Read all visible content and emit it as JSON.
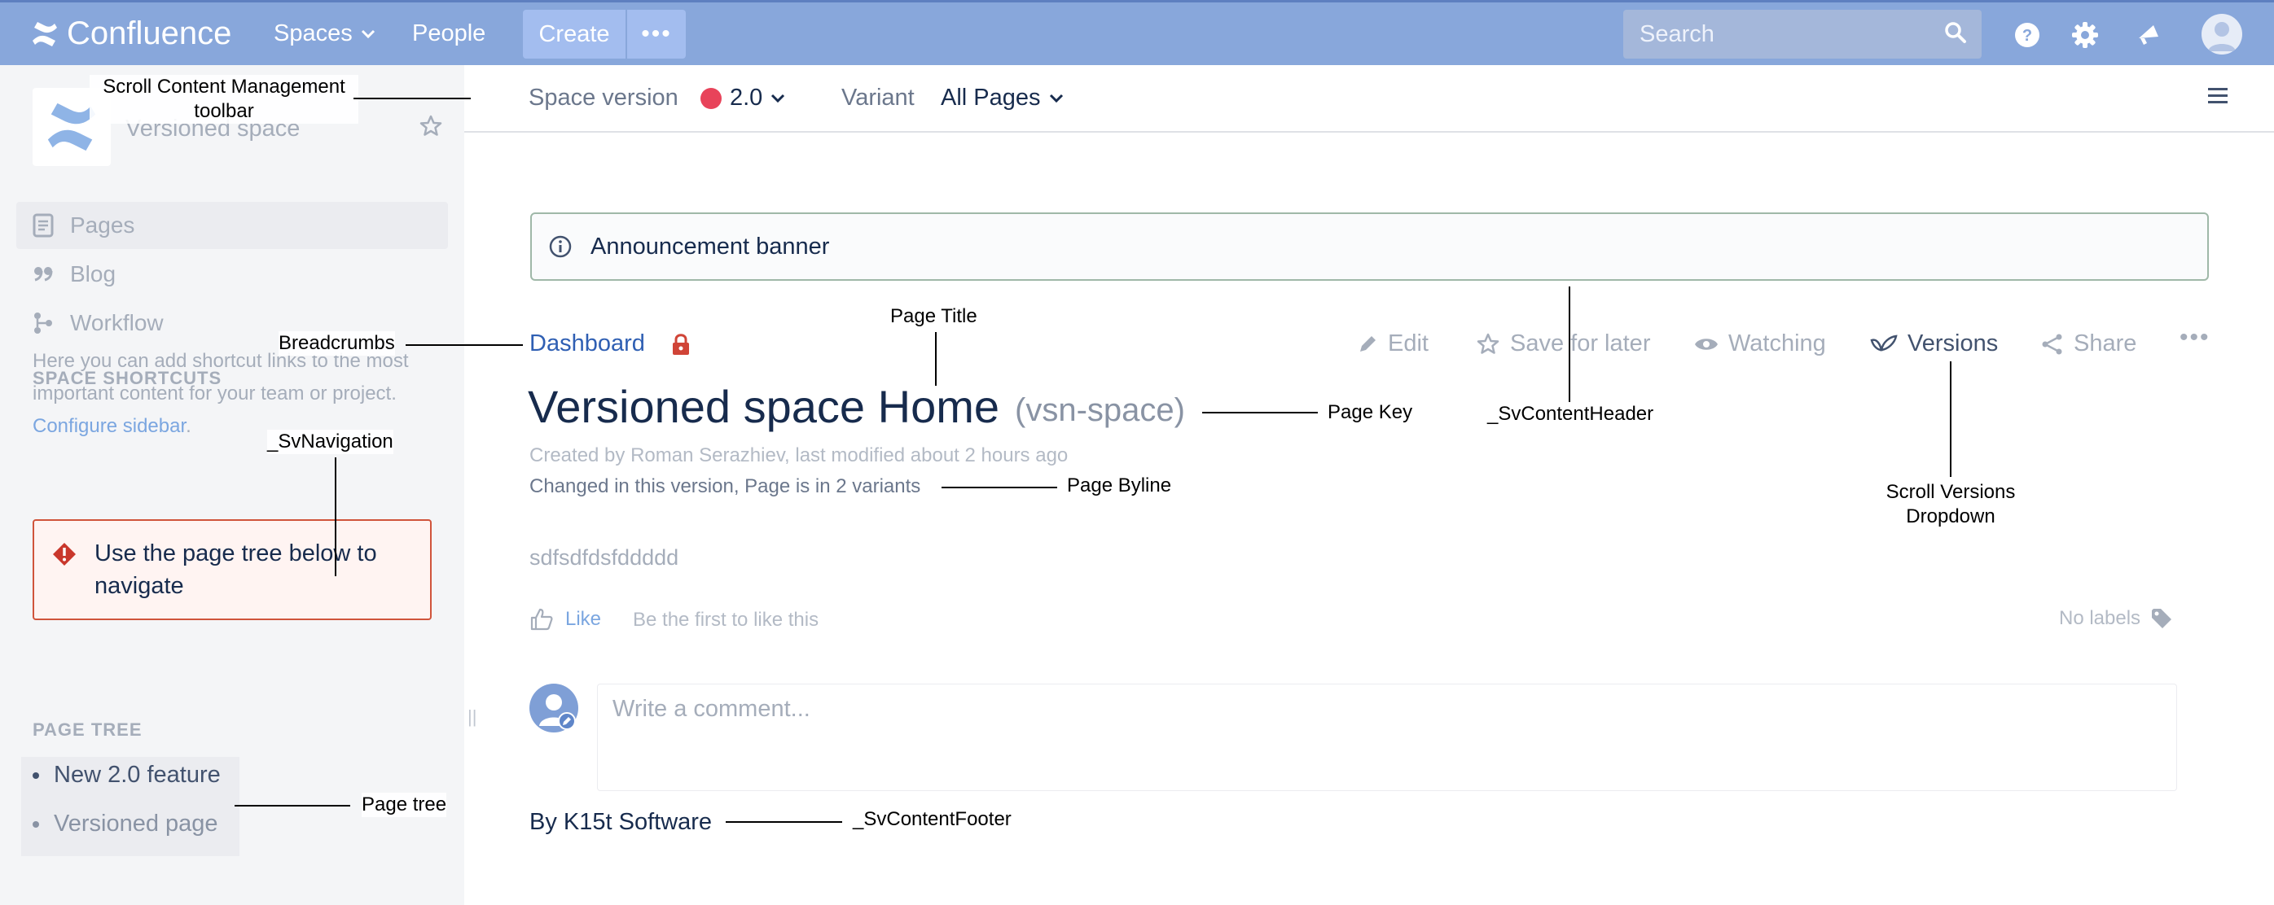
{
  "topbar": {
    "brand": "Confluence",
    "spaces_label": "Spaces",
    "people_label": "People",
    "create_label": "Create",
    "more_label": "•••",
    "search_placeholder": "Search",
    "colors": {
      "bar": "#88a7db",
      "button": "#a3bdef"
    }
  },
  "sidebar": {
    "space_name": "Versioned space",
    "nav": [
      {
        "label": "Pages",
        "icon": "page-icon",
        "active": true
      },
      {
        "label": "Blog",
        "icon": "quote-icon",
        "active": false
      },
      {
        "label": "Workflow",
        "icon": "workflow-icon",
        "active": false
      }
    ],
    "shortcuts_heading": "SPACE SHORTCUTS",
    "shortcuts_text": "Here you can add shortcut links to the most important content for your team or project. ",
    "configure_link": "Configure sidebar",
    "configure_suffix": ".",
    "warning_text": "Use the page tree below to navigate",
    "page_tree_heading": "PAGE TREE",
    "page_tree": [
      {
        "label": "New 2.0 feature"
      },
      {
        "label": "Versioned page"
      }
    ]
  },
  "toolbar": {
    "space_version_label": "Space version",
    "version_value": "2.0",
    "variant_label": "Variant",
    "variant_value": "All Pages",
    "version_dot_color": "#e8435a"
  },
  "banner": {
    "text": "Announcement banner"
  },
  "page": {
    "breadcrumb": "Dashboard",
    "actions": {
      "edit": "Edit",
      "save_for_later": "Save for later",
      "watching": "Watching",
      "versions": "Versions",
      "share": "Share",
      "more": "•••"
    },
    "title": "Versioned space Home",
    "key": "(vsn-space)",
    "created": "Created by Roman Serazhiev, last modified about 2 hours ago",
    "changed": "Changed in this version, Page is in 2 variants",
    "body": "sdfsdfdsfddddd",
    "like_label": "Like",
    "like_note": "Be the first to like this",
    "labels_text": "No labels",
    "comment_placeholder": "Write a comment...",
    "footer": "By K15t Software"
  },
  "annotations": {
    "toolbar": "Scroll Content Management toolbar",
    "breadcrumbs": "Breadcrumbs",
    "page_title": "Page Title",
    "page_key": "Page Key",
    "content_header": "_SvContentHeader",
    "navigation": "_SvNavigation",
    "byline": "Page Byline",
    "versions_dropdown": "Scroll Versions Dropdown",
    "page_tree": "Page tree",
    "content_footer": "_SvContentFooter"
  }
}
